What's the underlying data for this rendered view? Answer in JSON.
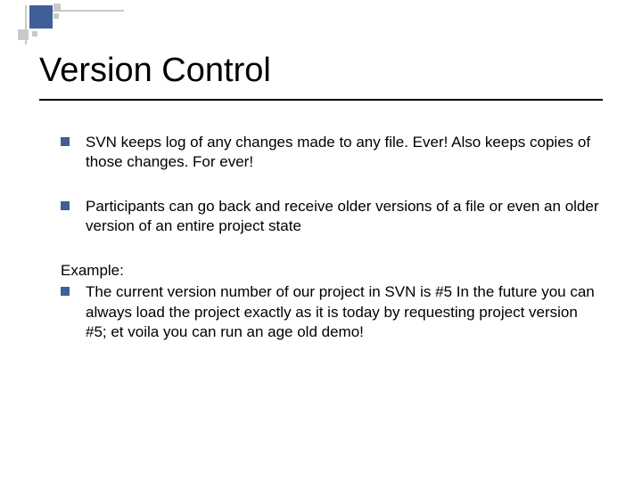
{
  "title": "Version Control",
  "bullets": [
    "SVN keeps log of any changes made to any file. Ever! Also keeps copies of those changes. For ever!",
    "Participants can go back and receive older versions of a file or even an older version of an entire project state"
  ],
  "example_label": "Example:",
  "example_bullet": "The current version number of our project in SVN is #5 In the future you can always load the project exactly as it is today by requesting project version #5; et voila you can run an age old demo!"
}
